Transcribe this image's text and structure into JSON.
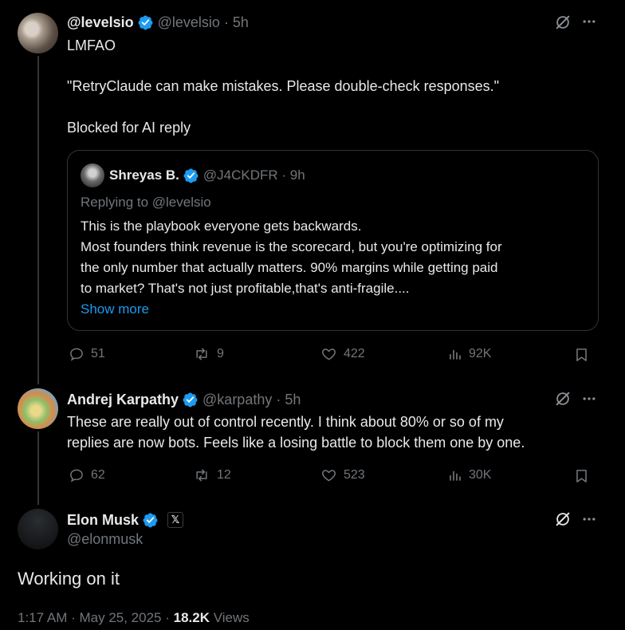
{
  "tweet1": {
    "name": "@levelsio",
    "handle": "@levelsio",
    "time": "5h",
    "text_line1": "LMFAO",
    "text_line2": "\"RetryClaude can make mistakes. Please double-check responses.\"",
    "text_line3": "Blocked for AI reply",
    "quote": {
      "name": "Shreyas B.",
      "handle": "@J4CKDFR",
      "time": "9h",
      "replying_to": "Replying to @levelsio",
      "lines": [
        "This is the playbook everyone gets backwards.",
        "Most founders think revenue is the scorecard, but you're optimizing for",
        "the only number that actually matters. 90% margins while getting paid",
        "to market? That's not just profitable,that's anti-fragile...."
      ],
      "show_more": "Show more"
    },
    "actions": {
      "replies": "51",
      "reposts": "9",
      "likes": "422",
      "views": "92K"
    }
  },
  "tweet2": {
    "name": "Andrej Karpathy",
    "handle": "@karpathy",
    "time": "5h",
    "lines": [
      "These are really out of control recently. I think about 80% or so of my",
      "replies are now bots. Feels like a losing battle to block them one by one."
    ],
    "actions": {
      "replies": "62",
      "reposts": "12",
      "likes": "523",
      "views": "30K"
    }
  },
  "tweet3": {
    "name": "Elon Musk",
    "affiliate_badge": "𝕏",
    "handle": "@elonmusk",
    "text": "Working on it",
    "meta_time": "1:17 AM · May 25, 2025 · ",
    "meta_views_count": "18.2K",
    "meta_views_label": " Views"
  },
  "colors": {
    "verified_blue": "#1d9bf0",
    "muted_text": "#71767b",
    "primary_text": "#e7e9ea",
    "border": "#2f3336"
  },
  "icons": [
    "verified-badge-icon",
    "grok-icon",
    "more-icon",
    "reply-icon",
    "repost-icon",
    "like-icon",
    "views-icon",
    "bookmark-icon"
  ]
}
